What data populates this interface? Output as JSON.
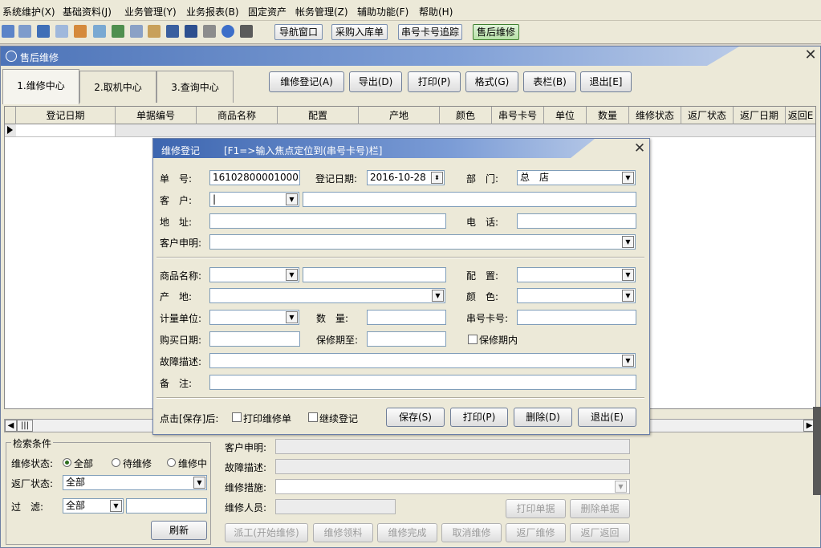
{
  "menu": [
    "系统维护(X)",
    "基础资料(J)",
    "业务管理(Y)",
    "业务报表(B)",
    "固定资产",
    "帐务管理(Z)",
    "辅助功能(F)",
    "帮助(H)"
  ],
  "toolbar": {
    "buttons": [
      "导航窗口",
      "采购入库单",
      "串号卡号追踪",
      "售后维修"
    ]
  },
  "main": {
    "title": "售后维修",
    "tabs": [
      "1.维修中心",
      "2.取机中心",
      "3.查询中心"
    ],
    "actions": [
      "维修登记(A)",
      "导出(D)",
      "打印(P)",
      "格式(G)",
      "表栏(B)",
      "退出[E]"
    ],
    "grid_columns": [
      "登记日期",
      "单据编号",
      "商品名称",
      "配置",
      "产地",
      "颜色",
      "串号卡号",
      "单位",
      "数量",
      "维修状态",
      "返厂状态",
      "返厂日期",
      "返回E"
    ]
  },
  "search": {
    "title": "检索条件",
    "repair_status_label": "维修状态:",
    "repair_status_options": [
      "全部",
      "待维修",
      "维修中"
    ],
    "return_status_label": "返厂状态:",
    "return_status_value": "全部",
    "filter_label": "过　滤:",
    "filter_value": "全部",
    "refresh": "刷新"
  },
  "details": {
    "customer_statement_label": "客户申明:",
    "fault_label": "故障描述:",
    "measure_label": "维修措施:",
    "staff_label": "维修人员:",
    "buttons_top": [
      "打印单据",
      "删除单据"
    ],
    "buttons_bottom": [
      "派工(开始维修)",
      "维修领料",
      "维修完成",
      "取消维修",
      "返厂维修",
      "返厂返回"
    ]
  },
  "dialog": {
    "title": "维修登记",
    "hint": "[F1=>输入焦点定位到(串号卡号)栏]",
    "order_no_label": "单　号:",
    "order_no": "161028000010001",
    "date_label": "登记日期:",
    "date": "2016-10-28",
    "dept_label": "部　门:",
    "dept": "总　店",
    "customer_label": "客　户:",
    "customer_value": "|",
    "address_label": "地　址:",
    "phone_label": "电　话:",
    "statement_label": "客户申明:",
    "product_label": "商品名称:",
    "config_label": "配　置:",
    "origin_label": "产　地:",
    "color_label": "颜　色:",
    "unit_label": "计量单位:",
    "qty_label": "数　量:",
    "serial_label": "串号卡号:",
    "buy_date_label": "购买日期:",
    "warranty_label": "保修期至:",
    "in_warranty_label": "保修期内",
    "fault_label": "故障描述:",
    "note_label": "备　注:",
    "after_save_label": "点击[保存]后:",
    "print_check_label": "打印维修单",
    "continue_check_label": "继续登记",
    "buttons": [
      "保存(S)",
      "打印(P)",
      "删除(D)",
      "退出(E)"
    ]
  },
  "colors": {
    "title_bar": "#4d74b8",
    "window_bg": "#ece9d8",
    "active_tool": "#b8e2a8"
  }
}
